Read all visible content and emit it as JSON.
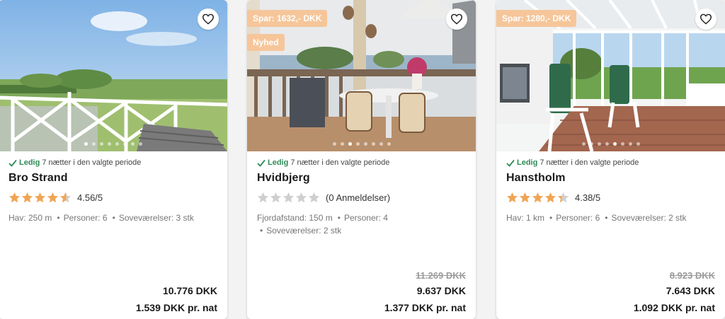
{
  "colors": {
    "badge": "#f6c69a",
    "star_filled": "#f0a554",
    "star_empty": "#cfcfcf",
    "check": "#2e8b57"
  },
  "cards": [
    {
      "badges": [],
      "availability": {
        "status": "Ledig",
        "text": "7 nætter i den valgte periode"
      },
      "title": "Bro Strand",
      "rating": {
        "value": 4.56,
        "text": "4.56/5"
      },
      "facts": [
        "Hav: 250 m",
        "Personer: 6",
        "Soveværelser: 3 stk"
      ],
      "price": {
        "old": "",
        "total": "10.776 DKK",
        "per_night": "1.539 DKK pr. nat"
      },
      "favorite_icon": "heart-icon"
    },
    {
      "badges": [
        "Spar: 1632,- DKK",
        "Nyhed"
      ],
      "availability": {
        "status": "Ledig",
        "text": "7 nætter i den valgte periode"
      },
      "title": "Hvidbjerg",
      "rating": {
        "value": 0,
        "text": "(0 Anmeldelser)"
      },
      "facts": [
        "Fjordafstand: 150 m",
        "Personer: 4",
        "Soveværelser: 2 stk"
      ],
      "price": {
        "old": "11.269 DKK",
        "total": "9.637 DKK",
        "per_night": "1.377 DKK pr. nat"
      },
      "favorite_icon": "heart-icon"
    },
    {
      "badges": [
        "Spar: 1280,- DKK"
      ],
      "availability": {
        "status": "Ledig",
        "text": "7 nætter i den valgte periode"
      },
      "title": "Hanstholm",
      "rating": {
        "value": 4.38,
        "text": "4.38/5"
      },
      "facts": [
        "Hav: 1 km",
        "Personer: 6",
        "Soveværelser: 2 stk"
      ],
      "price": {
        "old": "8.923 DKK",
        "total": "7.643 DKK",
        "per_night": "1.092 DKK pr. nat"
      },
      "favorite_icon": "heart-icon"
    }
  ]
}
